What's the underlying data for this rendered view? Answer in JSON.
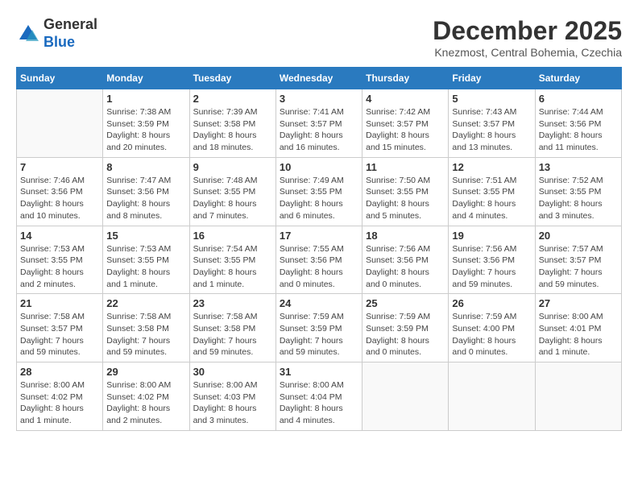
{
  "header": {
    "logo_line1": "General",
    "logo_line2": "Blue",
    "month_title": "December 2025",
    "location": "Knezmost, Central Bohemia, Czechia"
  },
  "weekdays": [
    "Sunday",
    "Monday",
    "Tuesday",
    "Wednesday",
    "Thursday",
    "Friday",
    "Saturday"
  ],
  "weeks": [
    [
      {
        "day": null,
        "info": null
      },
      {
        "day": "1",
        "info": "Sunrise: 7:38 AM\nSunset: 3:59 PM\nDaylight: 8 hours\nand 20 minutes."
      },
      {
        "day": "2",
        "info": "Sunrise: 7:39 AM\nSunset: 3:58 PM\nDaylight: 8 hours\nand 18 minutes."
      },
      {
        "day": "3",
        "info": "Sunrise: 7:41 AM\nSunset: 3:57 PM\nDaylight: 8 hours\nand 16 minutes."
      },
      {
        "day": "4",
        "info": "Sunrise: 7:42 AM\nSunset: 3:57 PM\nDaylight: 8 hours\nand 15 minutes."
      },
      {
        "day": "5",
        "info": "Sunrise: 7:43 AM\nSunset: 3:57 PM\nDaylight: 8 hours\nand 13 minutes."
      },
      {
        "day": "6",
        "info": "Sunrise: 7:44 AM\nSunset: 3:56 PM\nDaylight: 8 hours\nand 11 minutes."
      }
    ],
    [
      {
        "day": "7",
        "info": "Sunrise: 7:46 AM\nSunset: 3:56 PM\nDaylight: 8 hours\nand 10 minutes."
      },
      {
        "day": "8",
        "info": "Sunrise: 7:47 AM\nSunset: 3:56 PM\nDaylight: 8 hours\nand 8 minutes."
      },
      {
        "day": "9",
        "info": "Sunrise: 7:48 AM\nSunset: 3:55 PM\nDaylight: 8 hours\nand 7 minutes."
      },
      {
        "day": "10",
        "info": "Sunrise: 7:49 AM\nSunset: 3:55 PM\nDaylight: 8 hours\nand 6 minutes."
      },
      {
        "day": "11",
        "info": "Sunrise: 7:50 AM\nSunset: 3:55 PM\nDaylight: 8 hours\nand 5 minutes."
      },
      {
        "day": "12",
        "info": "Sunrise: 7:51 AM\nSunset: 3:55 PM\nDaylight: 8 hours\nand 4 minutes."
      },
      {
        "day": "13",
        "info": "Sunrise: 7:52 AM\nSunset: 3:55 PM\nDaylight: 8 hours\nand 3 minutes."
      }
    ],
    [
      {
        "day": "14",
        "info": "Sunrise: 7:53 AM\nSunset: 3:55 PM\nDaylight: 8 hours\nand 2 minutes."
      },
      {
        "day": "15",
        "info": "Sunrise: 7:53 AM\nSunset: 3:55 PM\nDaylight: 8 hours\nand 1 minute."
      },
      {
        "day": "16",
        "info": "Sunrise: 7:54 AM\nSunset: 3:55 PM\nDaylight: 8 hours\nand 1 minute."
      },
      {
        "day": "17",
        "info": "Sunrise: 7:55 AM\nSunset: 3:56 PM\nDaylight: 8 hours\nand 0 minutes."
      },
      {
        "day": "18",
        "info": "Sunrise: 7:56 AM\nSunset: 3:56 PM\nDaylight: 8 hours\nand 0 minutes."
      },
      {
        "day": "19",
        "info": "Sunrise: 7:56 AM\nSunset: 3:56 PM\nDaylight: 7 hours\nand 59 minutes."
      },
      {
        "day": "20",
        "info": "Sunrise: 7:57 AM\nSunset: 3:57 PM\nDaylight: 7 hours\nand 59 minutes."
      }
    ],
    [
      {
        "day": "21",
        "info": "Sunrise: 7:58 AM\nSunset: 3:57 PM\nDaylight: 7 hours\nand 59 minutes."
      },
      {
        "day": "22",
        "info": "Sunrise: 7:58 AM\nSunset: 3:58 PM\nDaylight: 7 hours\nand 59 minutes."
      },
      {
        "day": "23",
        "info": "Sunrise: 7:58 AM\nSunset: 3:58 PM\nDaylight: 7 hours\nand 59 minutes."
      },
      {
        "day": "24",
        "info": "Sunrise: 7:59 AM\nSunset: 3:59 PM\nDaylight: 7 hours\nand 59 minutes."
      },
      {
        "day": "25",
        "info": "Sunrise: 7:59 AM\nSunset: 3:59 PM\nDaylight: 8 hours\nand 0 minutes."
      },
      {
        "day": "26",
        "info": "Sunrise: 7:59 AM\nSunset: 4:00 PM\nDaylight: 8 hours\nand 0 minutes."
      },
      {
        "day": "27",
        "info": "Sunrise: 8:00 AM\nSunset: 4:01 PM\nDaylight: 8 hours\nand 1 minute."
      }
    ],
    [
      {
        "day": "28",
        "info": "Sunrise: 8:00 AM\nSunset: 4:02 PM\nDaylight: 8 hours\nand 1 minute."
      },
      {
        "day": "29",
        "info": "Sunrise: 8:00 AM\nSunset: 4:02 PM\nDaylight: 8 hours\nand 2 minutes."
      },
      {
        "day": "30",
        "info": "Sunrise: 8:00 AM\nSunset: 4:03 PM\nDaylight: 8 hours\nand 3 minutes."
      },
      {
        "day": "31",
        "info": "Sunrise: 8:00 AM\nSunset: 4:04 PM\nDaylight: 8 hours\nand 4 minutes."
      },
      {
        "day": null,
        "info": null
      },
      {
        "day": null,
        "info": null
      },
      {
        "day": null,
        "info": null
      }
    ]
  ]
}
